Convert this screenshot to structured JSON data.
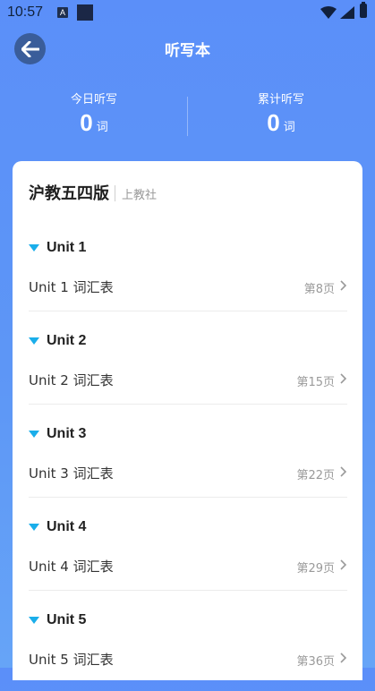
{
  "status_bar": {
    "time": "10:57",
    "icons": [
      "a-icon",
      "square-icon",
      "wifi-icon",
      "signal-icon",
      "battery-icon"
    ],
    "a_icon_text": "A"
  },
  "header": {
    "title": "听写本",
    "back_icon": "arrow-left-icon"
  },
  "stats": {
    "today_label": "今日听写",
    "today_value": "0",
    "total_label": "累计听写",
    "total_value": "0",
    "unit": "词"
  },
  "book": {
    "title": "沪教五四版",
    "publisher": "上教社"
  },
  "units": [
    {
      "title": "Unit 1",
      "vocab_label": "Unit 1 词汇表",
      "page": "第8页"
    },
    {
      "title": "Unit 2",
      "vocab_label": "Unit 2 词汇表",
      "page": "第15页"
    },
    {
      "title": "Unit 3",
      "vocab_label": "Unit 3 词汇表",
      "page": "第22页"
    },
    {
      "title": "Unit 4",
      "vocab_label": "Unit 4 词汇表",
      "page": "第29页"
    },
    {
      "title": "Unit 5",
      "vocab_label": "Unit 5 词汇表",
      "page": "第36页"
    }
  ],
  "colors": {
    "accent": "#5b8ff9",
    "triangle": "#1aaeea",
    "back_button": "#3a5d9a"
  }
}
